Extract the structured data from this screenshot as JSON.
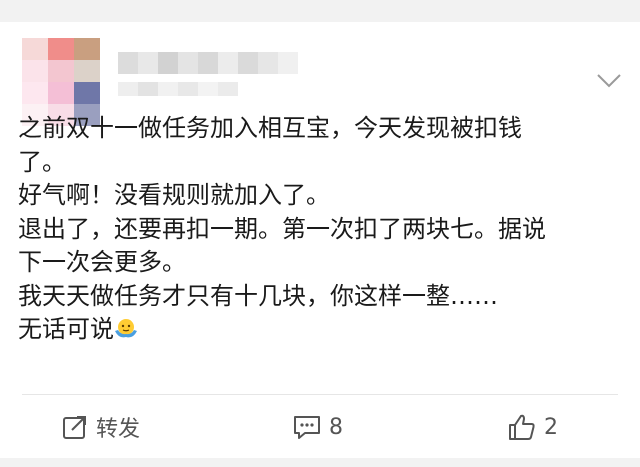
{
  "post": {
    "lines": [
      "之前双十一做任务加入相互宝，今天发现被扣钱",
      "了。",
      "好气啊！没看规则就加入了。",
      "退出了，还要再扣一期。第一次扣了两块七。据说",
      "下一次会更多。",
      "我天天做任务才只有十几块，你这样一整……",
      "无话可说"
    ],
    "emoji": "shrug-emoji"
  },
  "actions": {
    "repost_label": "转发",
    "comment_count": "8",
    "like_count": "2"
  },
  "icons": {
    "repost": "share-icon",
    "comment": "comment-icon",
    "like": "thumbs-up-icon",
    "menu": "chevron-down-icon"
  },
  "colors": {
    "text": "#1a1a1a",
    "action_text": "#555555",
    "divider": "#e6e6e6",
    "background": "#ffffff",
    "band": "#f2f2f2"
  }
}
